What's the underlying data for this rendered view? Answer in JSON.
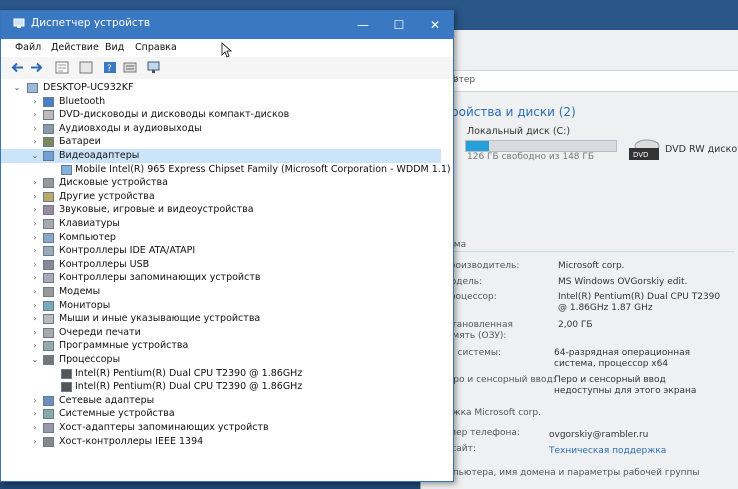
{
  "back_window": {
    "address_text": "ютер",
    "section_title": "ройства и диски (2)",
    "disk": {
      "label": "Локальный диск (C:)",
      "free_text": "126 ГБ свободно из 148 ГБ",
      "used_fraction": 0.15
    },
    "dvd_label": "DVD RW дисково",
    "system_heading": "тема",
    "fields": [
      {
        "key": "Производитель:",
        "value": "Microsoft corp."
      },
      {
        "key": "Модель:",
        "value": "MS Windows OVGorskiy edit."
      },
      {
        "key": "Процессор:",
        "value": "Intel(R) Pentium(R) Dual  CPU  T2390  @ 1.86GHz   1.87 GHz"
      },
      {
        "key": "Установленная память (ОЗУ):",
        "value": "2,00 ГБ"
      },
      {
        "key": "ип системы:",
        "value": "64-разрядная операционная система, процессор x64"
      },
      {
        "key": "Перо и сенсорный ввод:",
        "value": "Перо и сенсорный ввод недоступны для этого экрана"
      }
    ],
    "support_heading": "держка Microsoft corp.",
    "phone_key": "Номер телефона:",
    "phone_value": "ovgorskiy@rambler.ru",
    "site_key": "еб-сайт:",
    "site_value": "Техническая поддержка",
    "footer_text": "компьютера, имя домена и параметры рабочей группы"
  },
  "window": {
    "title": "Диспетчер устройств",
    "minimize": "—",
    "maximize": "☐",
    "close": "✕"
  },
  "menu": [
    "Файл",
    "Действие",
    "Вид",
    "Справка"
  ],
  "tree": {
    "root": "DESKTOP-UC932KF",
    "items": [
      {
        "label": "Bluetooth",
        "icon": "bluetooth-icon",
        "expanded": false
      },
      {
        "label": "DVD-дисководы и дисководы компакт-дисков",
        "icon": "dvd-icon",
        "expanded": false
      },
      {
        "label": "Аудиовходы и аудиовыходы",
        "icon": "speaker-icon",
        "expanded": false
      },
      {
        "label": "Батареи",
        "icon": "battery-icon",
        "expanded": false
      },
      {
        "label": "Видеоадаптеры",
        "icon": "display-adapter-icon",
        "expanded": true,
        "children": [
          "Mobile Intel(R) 965 Express Chipset Family (Microsoft Corporation - WDDM 1.1)"
        ]
      },
      {
        "label": "Дисковые устройства",
        "icon": "disk-icon",
        "expanded": false
      },
      {
        "label": "Другие устройства",
        "icon": "unknown-device-icon",
        "expanded": false
      },
      {
        "label": "Звуковые, игровые и видеоустройства",
        "icon": "sound-icon",
        "expanded": false
      },
      {
        "label": "Клавиатуры",
        "icon": "keyboard-icon",
        "expanded": false
      },
      {
        "label": "Компьютер",
        "icon": "computer-icon",
        "expanded": false
      },
      {
        "label": "Контроллеры IDE ATA/ATAPI",
        "icon": "ide-icon",
        "expanded": false
      },
      {
        "label": "Контроллеры USB",
        "icon": "usb-icon",
        "expanded": false
      },
      {
        "label": "Контроллеры запоминающих устройств",
        "icon": "storage-controller-icon",
        "expanded": false
      },
      {
        "label": "Модемы",
        "icon": "modem-icon",
        "expanded": false
      },
      {
        "label": "Мониторы",
        "icon": "monitor-icon",
        "expanded": false
      },
      {
        "label": "Мыши и иные указывающие устройства",
        "icon": "mouse-icon",
        "expanded": false
      },
      {
        "label": "Очереди печати",
        "icon": "printer-icon",
        "expanded": false
      },
      {
        "label": "Программные устройства",
        "icon": "software-device-icon",
        "expanded": false
      },
      {
        "label": "Процессоры",
        "icon": "cpu-icon",
        "expanded": true,
        "children": [
          "Intel(R) Pentium(R) Dual  CPU  T2390  @ 1.86GHz",
          "Intel(R) Pentium(R) Dual  CPU  T2390  @ 1.86GHz"
        ]
      },
      {
        "label": "Сетевые адаптеры",
        "icon": "network-adapter-icon",
        "expanded": false
      },
      {
        "label": "Системные устройства",
        "icon": "system-device-icon",
        "expanded": false
      },
      {
        "label": "Хост-адаптеры запоминающих устройств",
        "icon": "storage-host-icon",
        "expanded": false
      },
      {
        "label": "Хост-контроллеры IEEE 1394",
        "icon": "ieee1394-icon",
        "expanded": false
      }
    ]
  },
  "colors": {
    "titlebar": "#3a78c2",
    "selection": "#cce4f7",
    "link": "#2a6db5"
  }
}
